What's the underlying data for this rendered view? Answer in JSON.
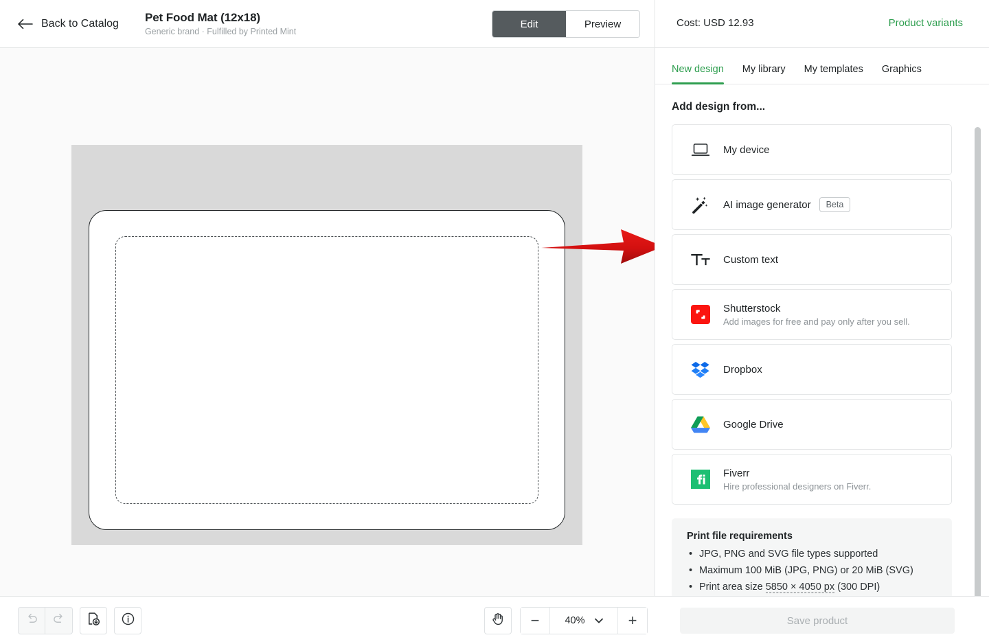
{
  "header": {
    "back_label": "Back to Catalog",
    "back_icon": "arrow-left-icon",
    "product_title": "Pet Food Mat (12x18)",
    "product_subtitle": "Generic brand · Fulfilled by Printed Mint",
    "mode_edit": "Edit",
    "mode_preview": "Preview",
    "active_mode": "Edit",
    "cost_label": "Cost: USD 12.93",
    "variants_link": "Product variants",
    "accent_green": "#2e9e4f",
    "active_segment_bg": "#555b5e"
  },
  "canvas": {
    "mat_background": "#d9d9d9",
    "mat_surface": "#ffffff",
    "print_area_style": "dashed"
  },
  "annotation": {
    "type": "red-arrow",
    "color": "#d31010",
    "points_to": "AI image generator"
  },
  "toolbar": {
    "undo_icon": "undo-icon",
    "redo_icon": "redo-icon",
    "download_icon": "file-download-icon",
    "info_icon": "info-circle-icon",
    "hand_icon": "hand-pan-icon",
    "zoom_out": "−",
    "zoom_level": "40%",
    "zoom_in": "+",
    "zoom_dropdown_icon": "chevron-down-icon"
  },
  "panel": {
    "tabs": [
      {
        "label": "New design",
        "active": true
      },
      {
        "label": "My library",
        "active": false
      },
      {
        "label": "My templates",
        "active": false
      },
      {
        "label": "Graphics",
        "active": false
      }
    ],
    "section_title": "Add design from...",
    "sources": [
      {
        "id": "my-device",
        "icon": "laptop-icon",
        "label": "My device",
        "desc": "",
        "badge": ""
      },
      {
        "id": "ai-image-generator",
        "icon": "magic-wand-icon",
        "label": "AI image generator",
        "desc": "",
        "badge": "Beta"
      },
      {
        "id": "custom-text",
        "icon": "text-size-icon",
        "label": "Custom text",
        "desc": "",
        "badge": ""
      },
      {
        "id": "shutterstock",
        "icon": "shutterstock-icon",
        "label": "Shutterstock",
        "desc": "Add images for free and pay only after you sell.",
        "badge": ""
      },
      {
        "id": "dropbox",
        "icon": "dropbox-icon",
        "label": "Dropbox",
        "desc": "",
        "badge": ""
      },
      {
        "id": "google-drive",
        "icon": "google-drive-icon",
        "label": "Google Drive",
        "desc": "",
        "badge": ""
      },
      {
        "id": "fiverr",
        "icon": "fiverr-icon",
        "label": "Fiverr",
        "desc": "Hire professional designers on Fiverr.",
        "badge": ""
      }
    ],
    "requirements": {
      "title": "Print file requirements",
      "items": [
        "JPG, PNG and SVG file types supported",
        "Maximum 100 MiB (JPG, PNG) or 20 MiB (SVG)",
        "Print area size 5850 × 4050 px (300 DPI)"
      ],
      "print_area_value": "5850 × 4050 px"
    },
    "save_button": "Save product"
  }
}
